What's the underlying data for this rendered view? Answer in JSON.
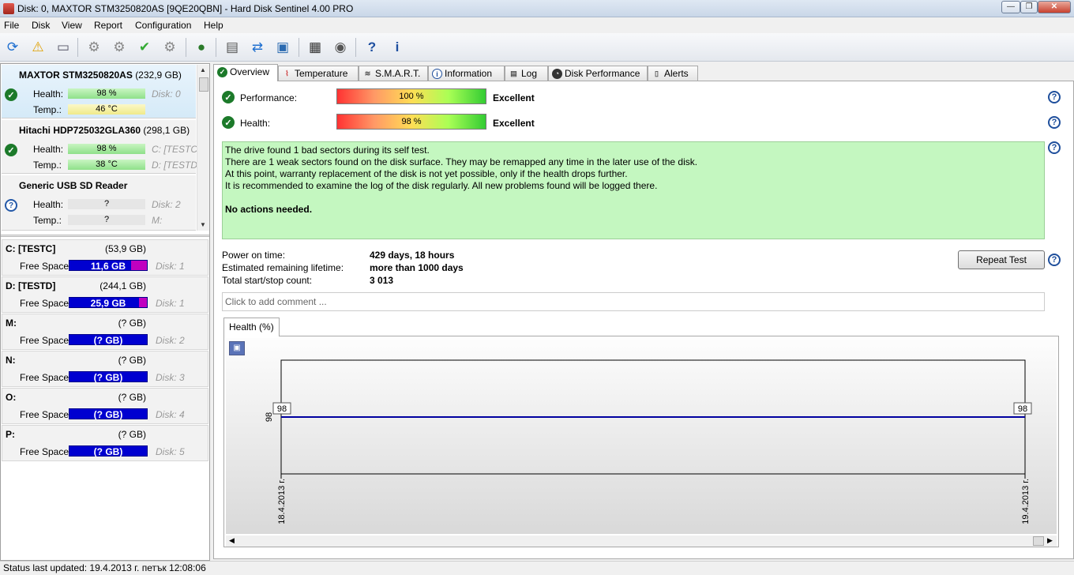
{
  "window": {
    "title": "Disk: 0, MAXTOR STM3250820AS [9QE20QBN]  -  Hard Disk Sentinel 4.00 PRO"
  },
  "menu": [
    "File",
    "Disk",
    "View",
    "Report",
    "Configuration",
    "Help"
  ],
  "disks": [
    {
      "name": "MAXTOR STM3250820AS",
      "size": "(232,9 GB)",
      "health_label": "Health:",
      "health": "98 %",
      "temp_label": "Temp.:",
      "temp": "46 °C",
      "info1": "Disk: 0",
      "info2": "",
      "status": "ok",
      "health_color": "green",
      "temp_color": "yellow"
    },
    {
      "name": "Hitachi HDP725032GLA360",
      "size": "(298,1 GB)",
      "health_label": "Health:",
      "health": "98 %",
      "temp_label": "Temp.:",
      "temp": "38 °C",
      "info1": "C: [TESTC]",
      "info2": "D: [TESTD]",
      "status": "ok",
      "health_color": "green",
      "temp_color": "green"
    },
    {
      "name": "Generic USB SD Reader",
      "size": "",
      "health_label": "Health:",
      "health": "?",
      "temp_label": "Temp.:",
      "temp": "?",
      "info1": "Disk: 2",
      "info2": "M:",
      "status": "unknown",
      "health_color": "gray",
      "temp_color": "gray"
    }
  ],
  "volumes": [
    {
      "name": "C: [TESTC]",
      "size": "(53,9 GB)",
      "free_label": "Free Space",
      "free": "11,6 GB",
      "disk": "Disk: 1",
      "used_fraction": 0.2
    },
    {
      "name": "D: [TESTD]",
      "size": "(244,1 GB)",
      "free_label": "Free Space",
      "free": "25,9 GB",
      "disk": "Disk: 1",
      "used_fraction": 0.1
    },
    {
      "name": "M:",
      "size": "(? GB)",
      "free_label": "Free Space",
      "free": "(? GB)",
      "disk": "Disk: 2",
      "used_fraction": 0
    },
    {
      "name": "N:",
      "size": "(? GB)",
      "free_label": "Free Space",
      "free": "(? GB)",
      "disk": "Disk: 3",
      "used_fraction": 0
    },
    {
      "name": "O:",
      "size": "(? GB)",
      "free_label": "Free Space",
      "free": "(? GB)",
      "disk": "Disk: 4",
      "used_fraction": 0
    },
    {
      "name": "P:",
      "size": "(? GB)",
      "free_label": "Free Space",
      "free": "(? GB)",
      "disk": "Disk: 5",
      "used_fraction": 0
    }
  ],
  "tabs": [
    "Overview",
    "Temperature",
    "S.M.A.R.T.",
    "Information",
    "Log",
    "Disk Performance",
    "Alerts"
  ],
  "overview": {
    "performance_label": "Performance:",
    "performance_value": "100 %",
    "performance_rating": "Excellent",
    "performance_fraction": 1.0,
    "health_label": "Health:",
    "health_value": "98 %",
    "health_rating": "Excellent",
    "health_fraction": 0.98,
    "messages": [
      "The drive found 1 bad sectors during its self test.",
      "There are 1 weak sectors found on the disk surface. They may be remapped any time in the later use of the disk.",
      "At this point, warranty replacement of the disk is not yet possible, only if the health drops further.",
      "It is recommended to examine the log of the disk regularly. All new problems found will be logged there."
    ],
    "action": "No actions needed.",
    "power_on_label": "Power on time:",
    "power_on": "429 days, 18 hours",
    "lifetime_label": "Estimated remaining lifetime:",
    "lifetime": "more than 1000 days",
    "startstop_label": "Total start/stop count:",
    "startstop": "3 013",
    "repeat_button": "Repeat Test",
    "comment_placeholder": "Click to add comment ..."
  },
  "chart_tab": "Health (%)",
  "chart_data": {
    "type": "line",
    "x": [
      "18.4.2013 г.",
      "19.4.2013 г."
    ],
    "series": [
      {
        "values": [
          98,
          98
        ]
      }
    ],
    "ylabel_tick": "98",
    "color": "#0000a0"
  },
  "status": "Status last updated: 19.4.2013 г. петък 12:08:06"
}
